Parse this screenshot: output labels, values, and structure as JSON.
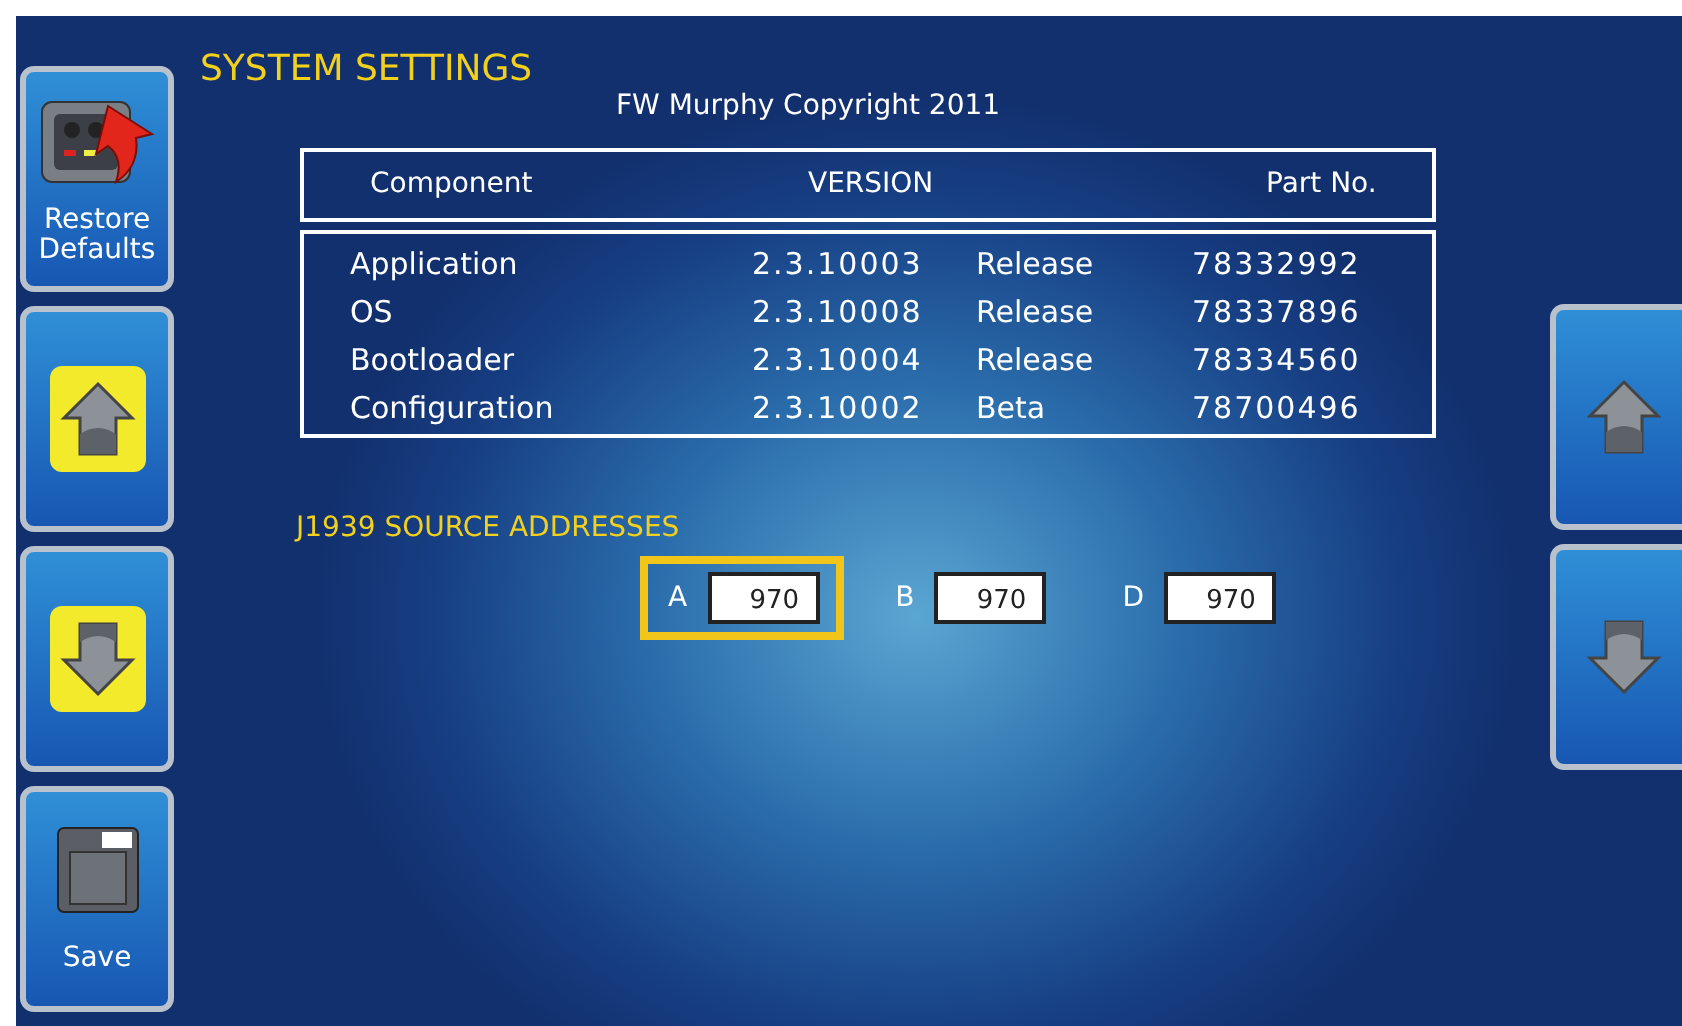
{
  "title": "SYSTEM SETTINGS",
  "copyright": "FW Murphy Copyright 2011",
  "left_buttons": [
    {
      "kind": "restore",
      "label": "Restore Defaults"
    },
    {
      "kind": "up"
    },
    {
      "kind": "down"
    },
    {
      "kind": "save",
      "label": "Save"
    }
  ],
  "right_buttons": [
    {
      "kind": "up"
    },
    {
      "kind": "down"
    }
  ],
  "table": {
    "columns": [
      "Component",
      "VERSION",
      "Part No."
    ],
    "rows": [
      {
        "component": "Application",
        "version": "2.3.10003",
        "status": "Release",
        "part_no": "78332992"
      },
      {
        "component": "OS",
        "version": "2.3.10008",
        "status": "Release",
        "part_no": "78337896"
      },
      {
        "component": "Bootloader",
        "version": "2.3.10004",
        "status": "Release",
        "part_no": "78334560"
      },
      {
        "component": "Configuration",
        "version": "2.3.10002",
        "status": "Beta",
        "part_no": "78700496"
      }
    ]
  },
  "source_addresses": {
    "title": "J1939 SOURCE ADDRESSES",
    "fields": [
      {
        "label": "A",
        "value": "970",
        "selected": true
      },
      {
        "label": "B",
        "value": "970",
        "selected": false
      },
      {
        "label": "D",
        "value": "970",
        "selected": false
      }
    ]
  }
}
